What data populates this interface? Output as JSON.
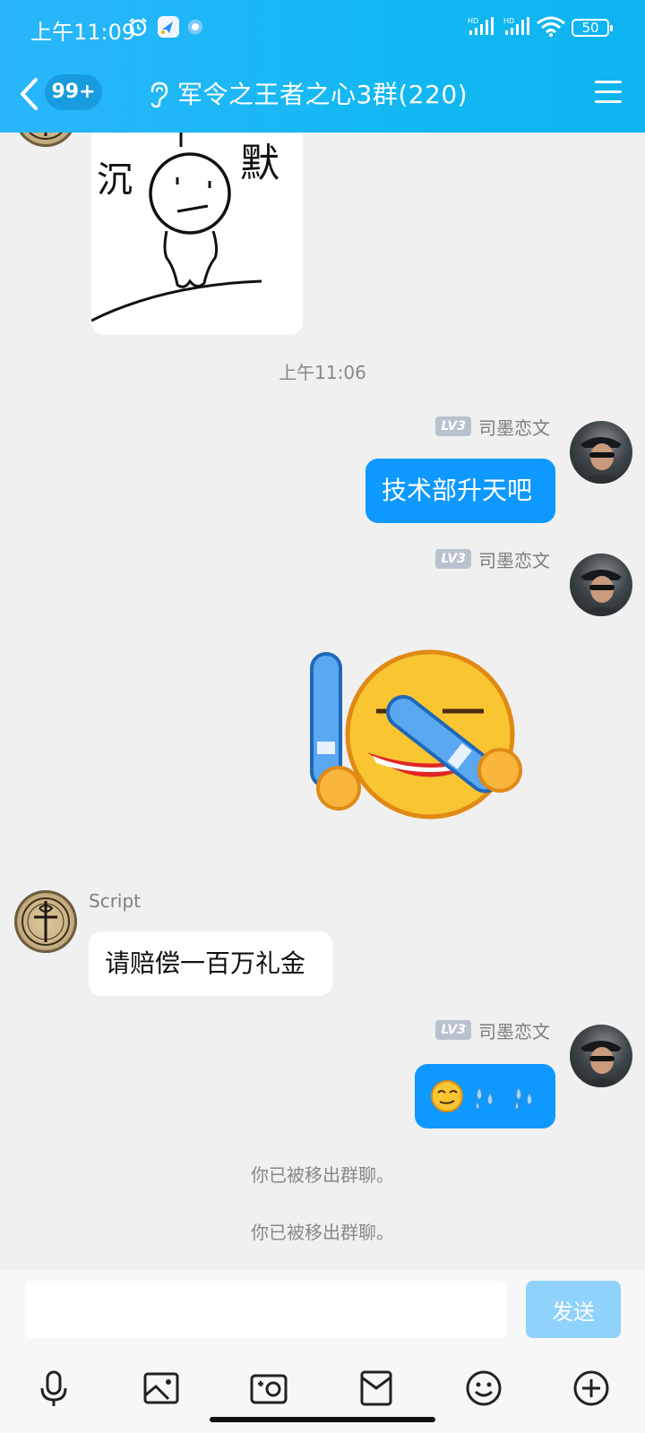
{
  "status_bar": {
    "time": "上午11:09",
    "battery": "50"
  },
  "header": {
    "back_badge": "99+",
    "title": "军令之王者之心3群(220)"
  },
  "messages": {
    "timestamp": "上午11:06",
    "msg1": {
      "level": "LV3",
      "sender": "司墨恋文",
      "text": "技术部升天吧"
    },
    "msg2": {
      "level": "LV3",
      "sender": "司墨恋文"
    },
    "msg3": {
      "sender": "Script",
      "text": "请赔偿一百万礼金"
    },
    "msg4": {
      "level": "LV3",
      "sender": "司墨恋文"
    },
    "system1": "你已被移出群聊。",
    "system2": "你已被移出群聊。"
  },
  "sticker_text": {
    "left": "沉",
    "right": "默"
  },
  "input": {
    "placeholder": "",
    "value": "",
    "send_label": "发送"
  },
  "colors": {
    "accent": "#0d99ff",
    "header": "#13b8f2"
  },
  "toolbar_icons": [
    "microphone-icon",
    "image-icon",
    "camera-icon",
    "red-packet-icon",
    "emoji-icon",
    "plus-icon"
  ]
}
